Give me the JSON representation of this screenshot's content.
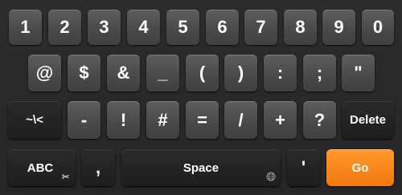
{
  "keyboard": {
    "row1": [
      "1",
      "2",
      "3",
      "4",
      "5",
      "6",
      "7",
      "8",
      "9",
      "0"
    ],
    "row2": [
      "@",
      "$",
      "&",
      "_",
      "(",
      ")",
      ":",
      ";",
      "\""
    ],
    "row3": {
      "toggle": "~\\<",
      "keys": [
        "-",
        "!",
        "#",
        "=",
        "/",
        "+",
        "?"
      ],
      "delete": "Delete"
    },
    "row4": {
      "abc": "ABC",
      "comma": ",",
      "space": "Space",
      "apostrophe": "'",
      "go": "Go"
    },
    "icons": {
      "abc_key_corner": "scissors-icon",
      "space_key_corner": "globe-icon"
    },
    "colors": {
      "background": "#2a2a2a",
      "key": "#4f4f4f",
      "dark_key": "#222222",
      "accent": "#f7841a",
      "text": "#ffffff"
    }
  }
}
